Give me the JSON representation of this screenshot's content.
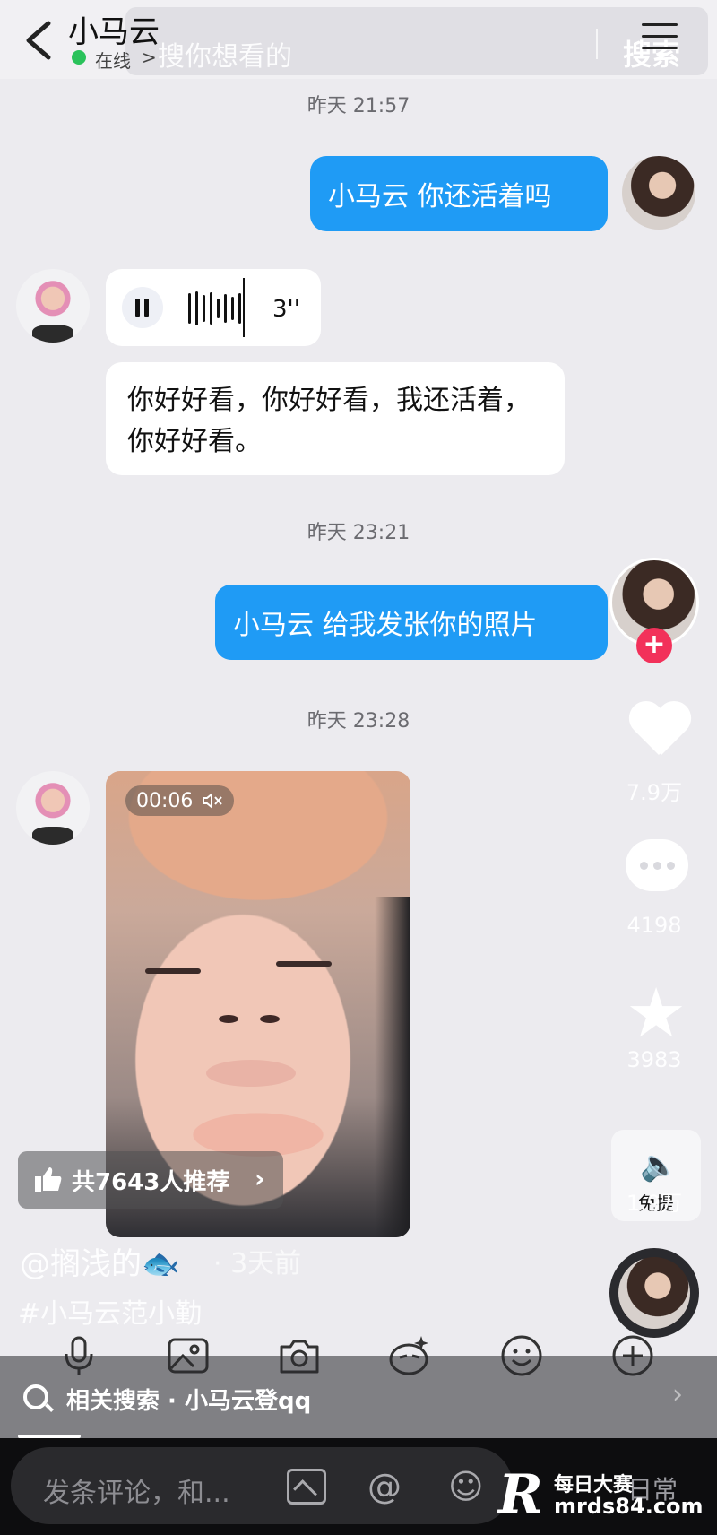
{
  "header": {
    "title": "小马云",
    "status": "在线",
    "search_placeholder": "搜你想看的",
    "search_button": "搜索"
  },
  "messages": {
    "ts1": "昨天 21:57",
    "out1": "小马云 你还活着吗",
    "voice_duration": "3''",
    "transcript": "你好好看，你好好看，我还活着，你好好看。",
    "ts2": "昨天 23:21",
    "out2": "小马云 给我发张你的照片",
    "ts3": "昨天 23:28",
    "video_time": "00:06"
  },
  "rail": {
    "likes": "7.9万",
    "comments": "4198",
    "favorites": "3983",
    "shares": "1.9万",
    "share_label": "免提",
    "follow": "+"
  },
  "overlay": {
    "recommend": "共7643人推荐",
    "author": "@搁浅的🐟",
    "author_time": "· 3天前",
    "hashtag": "#小马云范小勤"
  },
  "related": {
    "text": "相关搜索 · 小马云登qq"
  },
  "bottom": {
    "comment_placeholder": "发条评论，和...",
    "watermark_top": "每日大赛",
    "watermark_bottom": "mrds84.com",
    "daily": "日常"
  },
  "colors": {
    "outgoing_bubble": "#1f9bf5",
    "online_dot": "#2ac25b",
    "follow_plus": "#f2315a"
  }
}
